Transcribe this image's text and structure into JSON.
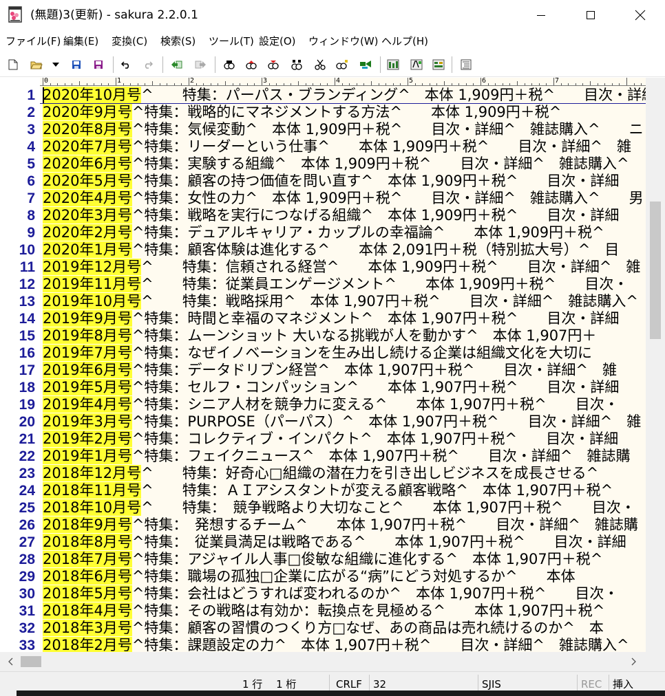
{
  "window": {
    "title": "(無題)3(更新) - sakura 2.2.0.1",
    "controls": [
      "minimize",
      "maximize",
      "close"
    ]
  },
  "menu": [
    {
      "label": "ファイル(F)"
    },
    {
      "label": "編集(E)"
    },
    {
      "label": "変換(C)"
    },
    {
      "label": "検索(S)"
    },
    {
      "label": "ツール(T)"
    },
    {
      "label": "設定(O)"
    },
    {
      "label": "ウィンドウ(W)"
    },
    {
      "label": "ヘルプ(H)"
    }
  ],
  "toolbar": [
    {
      "icon": "new-file-icon"
    },
    {
      "icon": "open-folder-icon"
    },
    {
      "icon": "dropdown-arrow-icon"
    },
    {
      "icon": "save-icon"
    },
    {
      "icon": "save-all-icon"
    },
    {
      "icon": "undo-icon"
    },
    {
      "icon": "redo-icon"
    },
    {
      "icon": "back-jump-icon"
    },
    {
      "icon": "forward-jump-icon"
    },
    {
      "icon": "search-icon"
    },
    {
      "icon": "search-prev-icon"
    },
    {
      "icon": "search-next-icon"
    },
    {
      "icon": "replace-icon"
    },
    {
      "icon": "cut-icon"
    },
    {
      "icon": "grep-icon"
    },
    {
      "icon": "mark-icon"
    },
    {
      "icon": "settings-icon"
    },
    {
      "icon": "font-settings-icon"
    },
    {
      "icon": "type-settings-icon"
    },
    {
      "icon": "outline-icon"
    }
  ],
  "ruler": {
    "marks": [
      "0",
      "1",
      "2",
      "3",
      "4",
      "5",
      "6",
      "7"
    ]
  },
  "editor": {
    "highlight_color": "#ffff33",
    "line_number_color": "#1c1c99",
    "background": "#fffbf0",
    "lines": [
      {
        "num": "1",
        "date": "2020年10月号",
        "pre": "",
        "rest": "^　　特集：パーパス・ブランディング^　本体 1,909円＋税^　　目次・詳細^　雑誌購入"
      },
      {
        "num": "2",
        "date": "2020年9月号",
        "pre": "",
        "rest": "^特集：戦略的にマネジメントする方法^　　本体 1,909円＋税^"
      },
      {
        "num": "3",
        "date": "2020年8月号",
        "pre": "",
        "rest": "^特集：気候変動^　本体 1,909円＋税^　　目次・詳細^　雑誌購入^　　ニ"
      },
      {
        "num": "4",
        "date": "2020年7月号",
        "pre": "",
        "rest": "^特集：リーダーという仕事^　　本体 1,909円＋税^　　目次・詳細^　雑"
      },
      {
        "num": "5",
        "date": "2020年6月号",
        "pre": "",
        "rest": "^特集：実験する組織^　本体 1,909円＋税^　　目次・詳細^　雑誌購入^"
      },
      {
        "num": "6",
        "date": "2020年5月号",
        "pre": "",
        "rest": "^特集：顧客の持つ価値を問い直す^　本体 1,909円＋税^　　目次・詳細"
      },
      {
        "num": "7",
        "date": "2020年4月号",
        "pre": "",
        "rest": "^特集：女性の力^　本体 1,909円＋税^　　目次・詳細^　雑誌購入^　　男"
      },
      {
        "num": "8",
        "date": "2020年3月号",
        "pre": "",
        "rest": "^特集：戦略を実行につなげる組織^　本体 1,909円＋税^　　目次・詳細"
      },
      {
        "num": "9",
        "date": "2020年2月号",
        "pre": "",
        "rest": "^特集：デュアルキャリア・カップルの幸福論^　　本体 1,909円＋税^"
      },
      {
        "num": "10",
        "date": "2020年1月号",
        "pre": "",
        "rest": "^特集：顧客体験は進化する^　　本体 2,091円＋税（特別拡大号）^　目"
      },
      {
        "num": "11",
        "date": "2019年12月号",
        "pre": "",
        "rest": "^　　特集：信頼される経営^　　本体 1,909円＋税^　　目次・詳細^　雑"
      },
      {
        "num": "12",
        "date": "2019年11月号",
        "pre": "",
        "rest": "^　　特集：従業員エンゲージメント^　　本体 1,909円＋税^　　目次・"
      },
      {
        "num": "13",
        "date": "2019年10月号",
        "pre": "",
        "rest": "^　　特集：戦略採用^　本体 1,907円＋税^　　目次・詳細^　雑誌購入^"
      },
      {
        "num": "14",
        "date": "2019年9月号",
        "pre": "",
        "rest": "^特集：時間と幸福のマネジメント^　本体 1,907円＋税^　　目次・詳細"
      },
      {
        "num": "15",
        "date": "2019年8月号",
        "pre": "",
        "rest": "^特集：ムーンショット 大いなる挑戦が人を動かす^　本体 1,907円＋"
      },
      {
        "num": "16",
        "date": "2019年7月号",
        "pre": "",
        "rest": "^特集：なぜイノベーションを生み出し続ける企業は組織文化を大切に"
      },
      {
        "num": "17",
        "date": "2019年6月号",
        "pre": "",
        "rest": "^特集：データドリブン経営^　本体 1,907円＋税^　　目次・詳細^　雑"
      },
      {
        "num": "18",
        "date": "2019年5月号",
        "pre": "",
        "rest": "^特集：セルフ・コンパッション^　　本体 1,907円＋税^　　目次・詳細"
      },
      {
        "num": "19",
        "date": "2019年4月号",
        "pre": "",
        "rest": "^特集：シニア人材を競争力に変える^　　本体 1,907円＋税^　　目次・"
      },
      {
        "num": "20",
        "date": "2019年3月号",
        "pre": "",
        "rest": "^特集：PURPOSE（パーパス）^　本体 1,907円＋税^　　目次・詳細^　雑"
      },
      {
        "num": "21",
        "date": "2019年2月号",
        "pre": "",
        "rest": "^特集：コレクティブ・インパクト^　本体 1,907円＋税^　　目次・詳細"
      },
      {
        "num": "22",
        "date": "2019年1月号",
        "pre": "",
        "rest": "^特集：フェイクニュース^　本体 1,907円＋税^　　目次・詳細^　雑誌購"
      },
      {
        "num": "23",
        "date": "2018年12月号",
        "pre": "",
        "rest": "^　　特集：好奇心□組織の潜在力を引き出しビジネスを成長させる^"
      },
      {
        "num": "24",
        "date": "2018年11月号",
        "pre": "",
        "rest": "^　　特集：ＡＩアシスタントが変える顧客戦略^　本体 1,907円＋税^"
      },
      {
        "num": "25",
        "date": "2018年10月号",
        "pre": "",
        "rest": "^　　特集：　競争戦略より大切なこと^　　本体 1,907円＋税^　　目次・"
      },
      {
        "num": "26",
        "date": "2018年9月号",
        "pre": "",
        "rest": "^特集：　発想するチーム^　　本体 1,907円＋税^　　目次・詳細^　雑誌購"
      },
      {
        "num": "27",
        "date": "2018年8月号",
        "pre": "",
        "rest": "^特集：　従業員満足は戦略である^　　本体 1,907円＋税^　　目次・詳細"
      },
      {
        "num": "28",
        "date": "2018年7月号",
        "pre": "",
        "rest": "^特集：アジャイル人事□俊敏な組織に進化する^　本体 1,907円＋税^"
      },
      {
        "num": "29",
        "date": "2018年6月号",
        "pre": "",
        "rest": "^特集：職場の孤独□企業に広がる“病”にどう対処するか^　　本体"
      },
      {
        "num": "30",
        "date": "2018年5月号",
        "pre": "",
        "rest": "^特集：会社はどうすれば変われるのか^　本体 1,907円＋税^　　目次・"
      },
      {
        "num": "31",
        "date": "2018年4月号",
        "pre": "",
        "rest": "^特集：その戦略は有効か：転換点を見極める^　　本体 1,907円＋税^"
      },
      {
        "num": "32",
        "date": "2018年3月号",
        "pre": "",
        "rest": "^特集：顧客の習慣のつくり方□なぜ、あの商品は売れ続けるのか^　本"
      },
      {
        "num": "33",
        "date": "2018年2月号",
        "pre": "",
        "rest": "^特集：課題設定の力^　本体 1,907円＋税^　　目次・詳細^　雑誌購入^"
      }
    ]
  },
  "status": {
    "position": "1 行　 1 桁",
    "line_ending": "CRLF",
    "char_code": "32",
    "encoding": "SJIS",
    "rec": "REC",
    "insert_mode": "挿入"
  }
}
